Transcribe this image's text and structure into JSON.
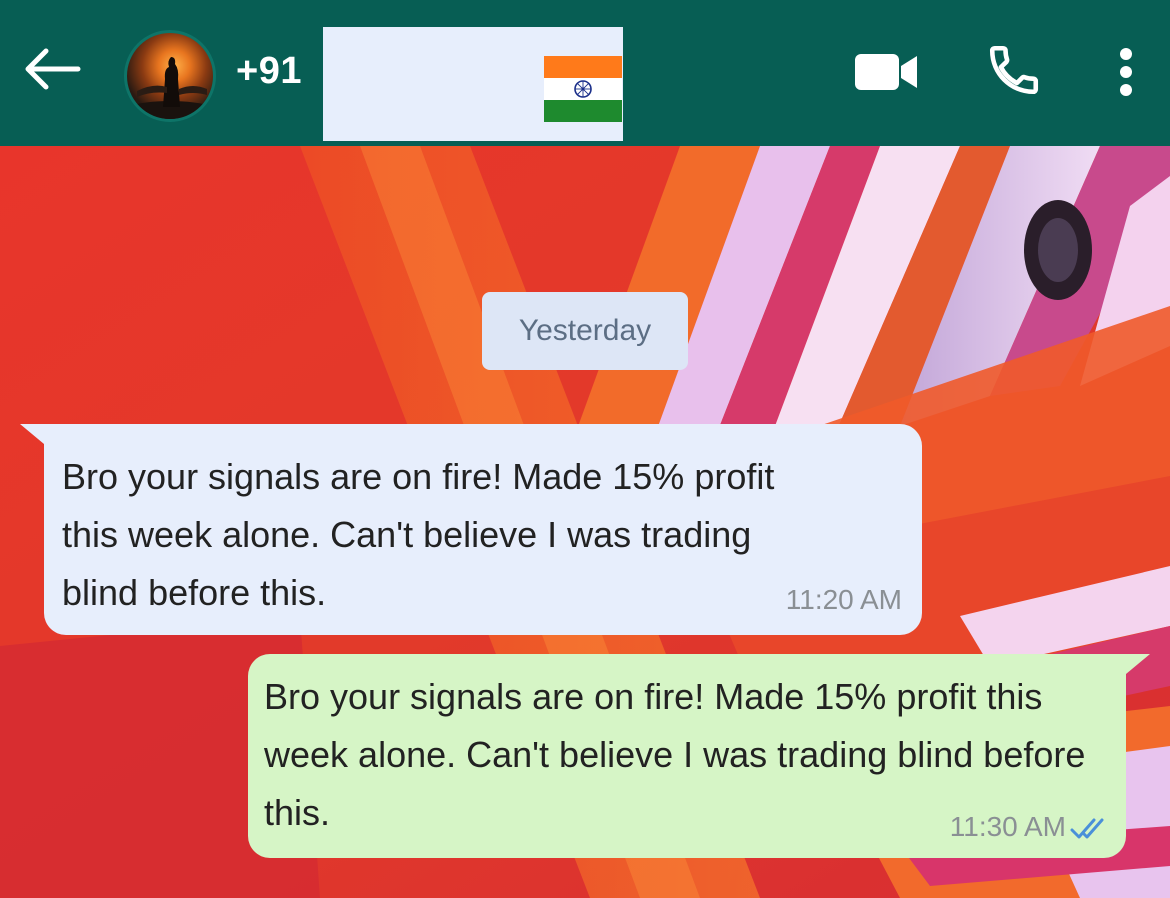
{
  "header": {
    "contact_number": "+91 ",
    "back_icon": "arrow-left-icon",
    "video_icon": "video-camera-icon",
    "call_icon": "phone-icon",
    "menu_icon": "more-vertical-icon",
    "flag": "india-flag",
    "background_color": "#075e54"
  },
  "chat": {
    "date_divider": "Yesterday",
    "messages": [
      {
        "direction": "incoming",
        "text": "Bro your signals are on fire! Made 15% profit this week alone. Can't believe I was trading blind before this.",
        "time": "11:20 AM",
        "bubble_color": "#e7eefc"
      },
      {
        "direction": "outgoing",
        "text": "Bro your signals are on fire! Made 15% profit this week alone. Can't believe I was trading blind before this.",
        "time": "11:30 AM",
        "status": "read",
        "status_icon": "double-check-icon",
        "bubble_color": "#d6f5c6"
      }
    ]
  },
  "colors": {
    "read_ticks": "#4a90d9",
    "wallpaper_base": "#e0302c"
  }
}
